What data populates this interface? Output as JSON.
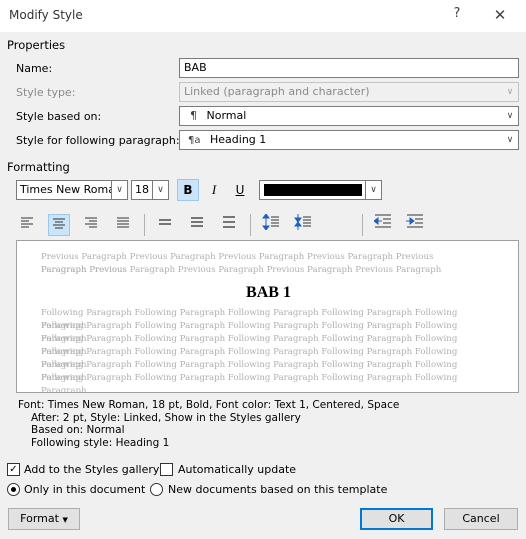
{
  "window": {
    "title": "Modify Style",
    "help_glyph": "?",
    "close_glyph": "✕"
  },
  "properties": {
    "section_label": "Properties",
    "name_label": "Name:",
    "name_value": "BAB",
    "style_type_label": "Style type:",
    "style_type_value": "Linked (paragraph and character)",
    "based_on_label": "Style based on:",
    "based_on_icon": "¶",
    "based_on_value": "Normal",
    "following_label": "Style for following paragraph:",
    "following_icon": "¶a",
    "following_value": "Heading 1"
  },
  "formatting": {
    "section_label": "Formatting",
    "font_name": "Times New Roman",
    "font_size": "18",
    "bold_label": "B",
    "italic_label": "I",
    "underline_label": "U",
    "font_color": "#000000"
  },
  "preview": {
    "previous_lines": [
      "Previous Paragraph Previous Paragraph Previous Paragraph Previous Paragraph Previous Paragraph Previous",
      "Paragraph Previous Paragraph Previous Paragraph Previous Paragraph Previous Paragraph"
    ],
    "sample_text": "BAB 1",
    "following_lines": [
      "Following Paragraph Following Paragraph Following Paragraph Following Paragraph Following Paragraph",
      "Following Paragraph Following Paragraph Following Paragraph Following Paragraph Following Paragraph",
      "Following Paragraph Following Paragraph Following Paragraph Following Paragraph Following Paragraph",
      "Following Paragraph Following Paragraph Following Paragraph Following Paragraph Following Paragraph",
      "Following Paragraph Following Paragraph Following Paragraph Following Paragraph Following Paragraph",
      "Following Paragraph Following Paragraph Following Paragraph Following Paragraph Following Paragraph"
    ]
  },
  "description": {
    "lines": [
      "Font: Times New Roman, 18 pt, Bold, Font color: Text 1, Centered, Space",
      "After:  2 pt, Style: Linked, Show in the Styles gallery",
      "Based on: Normal",
      "Following style: Heading 1"
    ]
  },
  "options": {
    "add_to_gallery": "Add to the Styles gallery",
    "auto_update": "Automatically update",
    "only_in_document": "Only in this document",
    "new_documents": "New documents based on this template"
  },
  "buttons": {
    "format": "Format",
    "ok": "OK",
    "cancel": "Cancel"
  }
}
